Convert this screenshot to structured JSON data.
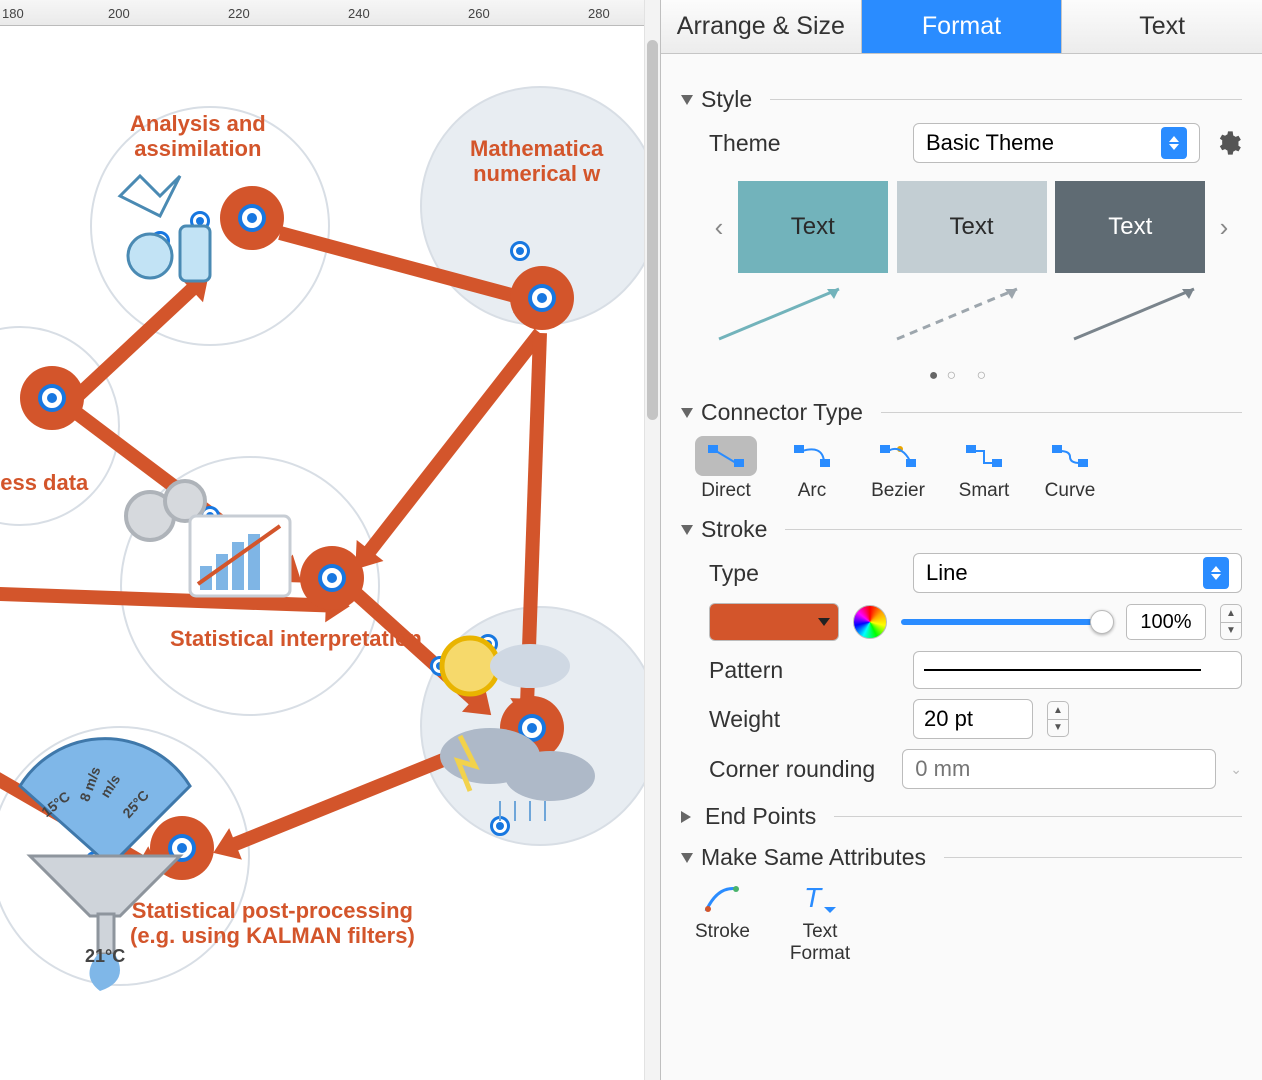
{
  "ruler": {
    "marks": [
      180,
      200,
      220,
      240,
      260,
      280
    ]
  },
  "canvas": {
    "labels": {
      "analysis": "Analysis and\nassimilation",
      "mathematical": "Mathematica\nnumerical w",
      "process_data": "cess data",
      "stat_interp": "Statistical interpretation",
      "stat_post": "Statistical post-processing\n(e.g. using KALMAN filters)",
      "temp_8ms": "8 m/s",
      "temp_ms": "m/s",
      "temp_15c": "15°C",
      "temp_25c": "25°C",
      "temp_21c": "21°C"
    }
  },
  "sidebar": {
    "tabs": {
      "arrange": "Arrange & Size",
      "format": "Format",
      "text": "Text"
    },
    "style": {
      "heading": "Style",
      "theme_label": "Theme",
      "theme_value": "Basic Theme",
      "swatches": [
        "Text",
        "Text",
        "Text"
      ]
    },
    "connector": {
      "heading": "Connector Type",
      "types": [
        "Direct",
        "Arc",
        "Bezier",
        "Smart",
        "Curve"
      ]
    },
    "stroke": {
      "heading": "Stroke",
      "type_label": "Type",
      "type_value": "Line",
      "opacity": "100%",
      "pattern_label": "Pattern",
      "weight_label": "Weight",
      "weight_value": "20 pt",
      "corner_label": "Corner rounding",
      "corner_placeholder": "0 mm",
      "color": "#d3552b"
    },
    "endpoints": {
      "heading": "End Points"
    },
    "same": {
      "heading": "Make Same Attributes",
      "stroke": "Stroke",
      "text_format": "Text\nFormat"
    }
  }
}
